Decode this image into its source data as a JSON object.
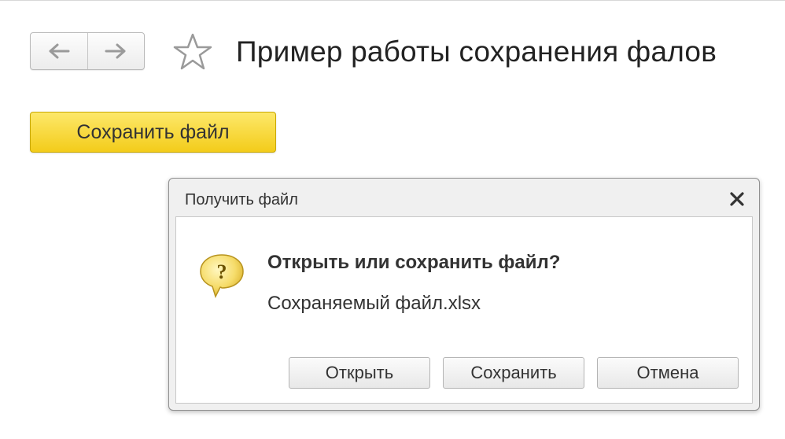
{
  "header": {
    "title": "Пример работы сохранения фалов",
    "back_icon": "arrow-left-icon",
    "forward_icon": "arrow-right-icon",
    "favorite_icon": "star-icon"
  },
  "main": {
    "save_file_label": "Сохранить файл",
    "save_file_color": "#f5d22c"
  },
  "dialog": {
    "title": "Получить файл",
    "close_icon": "close-icon",
    "question_icon": "question-bubble-icon",
    "question": "Открыть или сохранить файл?",
    "filename": "Сохраняемый файл.xlsx",
    "buttons": {
      "open": "Открыть",
      "save": "Сохранить",
      "cancel": "Отмена"
    }
  }
}
